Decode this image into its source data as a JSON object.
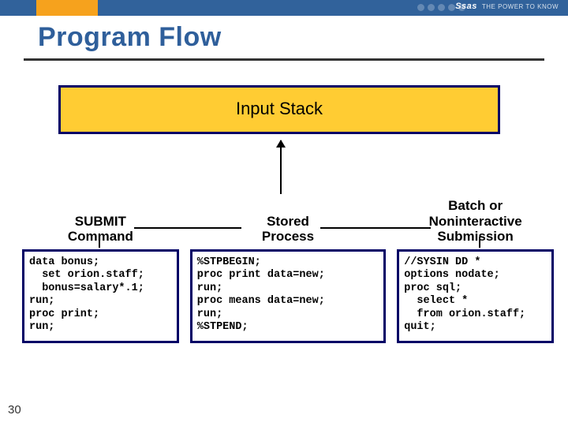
{
  "header": {
    "logo": "Ssas",
    "tagline": "THE POWER TO KNOW"
  },
  "title": "Program Flow",
  "input_stack": "Input Stack",
  "columns": [
    {
      "label": "SUBMIT\nCommand",
      "code": "data bonus;\n  set orion.staff;\n  bonus=salary*.1;\nrun;\nproc print;\nrun;"
    },
    {
      "label": "Stored\nProcess",
      "code": "%STPBEGIN;\nproc print data=new;\nrun;\nproc means data=new;\nrun;\n%STPEND;"
    },
    {
      "label": "Batch or\nNoninteractive\nSubmission",
      "code": "//SYSIN DD *\noptions nodate;\nproc sql;\n  select *\n  from orion.staff;\nquit;"
    }
  ],
  "page_number": "30",
  "colors": {
    "brand_blue": "#2f5f9b",
    "border_navy": "#000066",
    "accent_yellow": "#ffcc33",
    "accent_orange": "#f6a21d",
    "header_blue": "#31629b"
  }
}
